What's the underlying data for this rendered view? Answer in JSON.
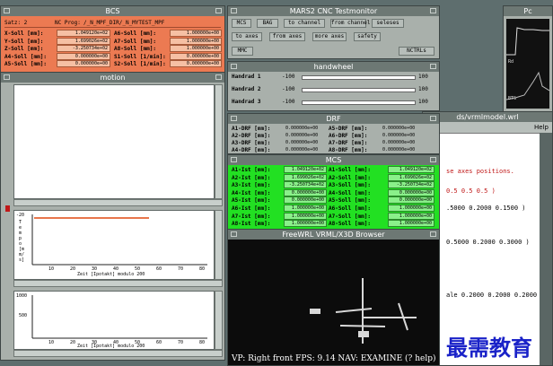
{
  "desktop": {
    "bg": "#5e6e6e"
  },
  "bcs": {
    "title": "BCS",
    "soll": "Satz: 2",
    "prog_label": "NC Prog:",
    "prog_value": "/_N_MPF_DIR/_N_MYTEST_MPF",
    "rows": [
      {
        "l1": "X-Soll [mm]:",
        "v1": "1.049120e+02",
        "l2": "A6-Soll [mm]:",
        "v2": "1.000000e+00"
      },
      {
        "l1": "Y-Soll [mm]:",
        "v1": "1.699026e+02",
        "l2": "A7-Soll [mm]:",
        "v2": "1.000000e+00"
      },
      {
        "l1": "Z-Soll [mm]:",
        "v1": "-3.250734e+02",
        "l2": "A8-Soll [mm]:",
        "v2": "1.000000e+00"
      },
      {
        "l1": "A4-Soll [mm]:",
        "v1": "0.000000e+00",
        "l2": "S1-Soll [1/min]:",
        "v2": "0.000000e+00"
      },
      {
        "l1": "A5-Soll [mm]:",
        "v1": "0.000000e+00",
        "l2": "S2-Soll [1/min]:",
        "v2": "0.000000e+00"
      }
    ]
  },
  "motion": {
    "title": "motion",
    "plot1": {
      "ylabel": "Tempo [mm/s]",
      "y_top": "-20",
      "xlabel": "Zeit [Ipotakt] modulo 200",
      "xticks": [
        "10",
        "20",
        "30",
        "40",
        "50",
        "60",
        "70",
        "80"
      ]
    },
    "plot2": {
      "y_top": "1000",
      "y_mid": "500",
      "xlabel": "Zeit [Ipotakt] modulo 200",
      "xticks": [
        "10",
        "20",
        "30",
        "40",
        "50",
        "60",
        "70",
        "80"
      ]
    }
  },
  "mars2": {
    "title": "MARS2 CNC Testmonitor",
    "row1": [
      "MCS",
      "BAG",
      "to channel",
      "from channel",
      "seleses"
    ],
    "row2": [
      "to axes",
      "from axes",
      "more axes",
      "safety"
    ],
    "row3": [
      "MMC",
      "NCTRLs"
    ]
  },
  "handwheel": {
    "title": "handwheel",
    "rows": [
      {
        "label": "Handrad 1",
        "min": "-100",
        "max": "100"
      },
      {
        "label": "Handrad 2",
        "min": "-100",
        "max": "100"
      },
      {
        "label": "Handrad 3",
        "min": "-100",
        "max": "100"
      }
    ]
  },
  "drf": {
    "title": "DRF",
    "rows": [
      {
        "l1": "A1-DRF [mm]:",
        "v1": "0.000000e+00",
        "l2": "A5-DRF [mm]:",
        "v2": "0.000000e+00"
      },
      {
        "l1": "A2-DRF [mm]:",
        "v1": "0.000000e+00",
        "l2": "A6-DRF [mm]:",
        "v2": "0.000000e+00"
      },
      {
        "l1": "A3-DRF [mm]:",
        "v1": "0.000000e+00",
        "l2": "A7-DRF [mm]:",
        "v2": "0.000000e+00"
      },
      {
        "l1": "A4-DRF [mm]:",
        "v1": "0.000000e+00",
        "l2": "A8-DRF [mm]:",
        "v2": "0.000000e+00"
      }
    ]
  },
  "mcs": {
    "title": "MCS",
    "rows": [
      {
        "l1": "A1-Ist [mm]:",
        "v1": "1.049120e+02",
        "l2": "A1-Soll [mm]:",
        "v2": "1.049120e+02"
      },
      {
        "l1": "A2-Ist [mm]:",
        "v1": "1.699026e+02",
        "l2": "A2-Soll [mm]:",
        "v2": "1.699026e+02"
      },
      {
        "l1": "A3-Ist [mm]:",
        "v1": "-3.250734e+02",
        "l2": "A3-Soll [mm]:",
        "v2": "-3.250734e+02"
      },
      {
        "l1": "A4-Ist [mm]:",
        "v1": "0.000000e+00",
        "l2": "A4-Soll [mm]:",
        "v2": "0.000000e+00"
      },
      {
        "l1": "A5-Ist [mm]:",
        "v1": "0.000000e+00",
        "l2": "A5-Soll [mm]:",
        "v2": "0.000000e+00"
      },
      {
        "l1": "A6-Ist [mm]:",
        "v1": "1.000000e+00",
        "l2": "A6-Soll [mm]:",
        "v2": "1.000000e+00"
      },
      {
        "l1": "A7-Ist [mm]:",
        "v1": "1.000000e+00",
        "l2": "A7-Soll [mm]:",
        "v2": "1.000000e+00"
      },
      {
        "l1": "A8-Ist [mm]:",
        "v1": "1.000000e+00",
        "l2": "A8-Soll [mm]:",
        "v2": "1.000000e+00"
      }
    ]
  },
  "freewrl": {
    "title": "FreeWRL VRML/X3D Browser",
    "status": "VP: Right front   FPS: 9.14  NAV: EXAMINE  (? help)"
  },
  "editor": {
    "title": "ds/vrmlmodel.wrl",
    "menu_help": "Help",
    "lines": [
      {
        "text": "se axes positions.",
        "red": true
      },
      {
        "text": "0.5 0.5 0.5 )",
        "red": true
      },
      {
        "text": ".5000 0.2000 0.1500 )",
        "red": false
      },
      {
        "text": "0.5000 0.2000 0.3000 )",
        "red": false
      },
      {
        "text": "ale 0.2000 0.2000 0.2000 )",
        "red": false
      }
    ]
  },
  "pc": {
    "title": "Pc",
    "label1": "Rd",
    "label2": "BTS"
  },
  "watermark": "最需教育"
}
